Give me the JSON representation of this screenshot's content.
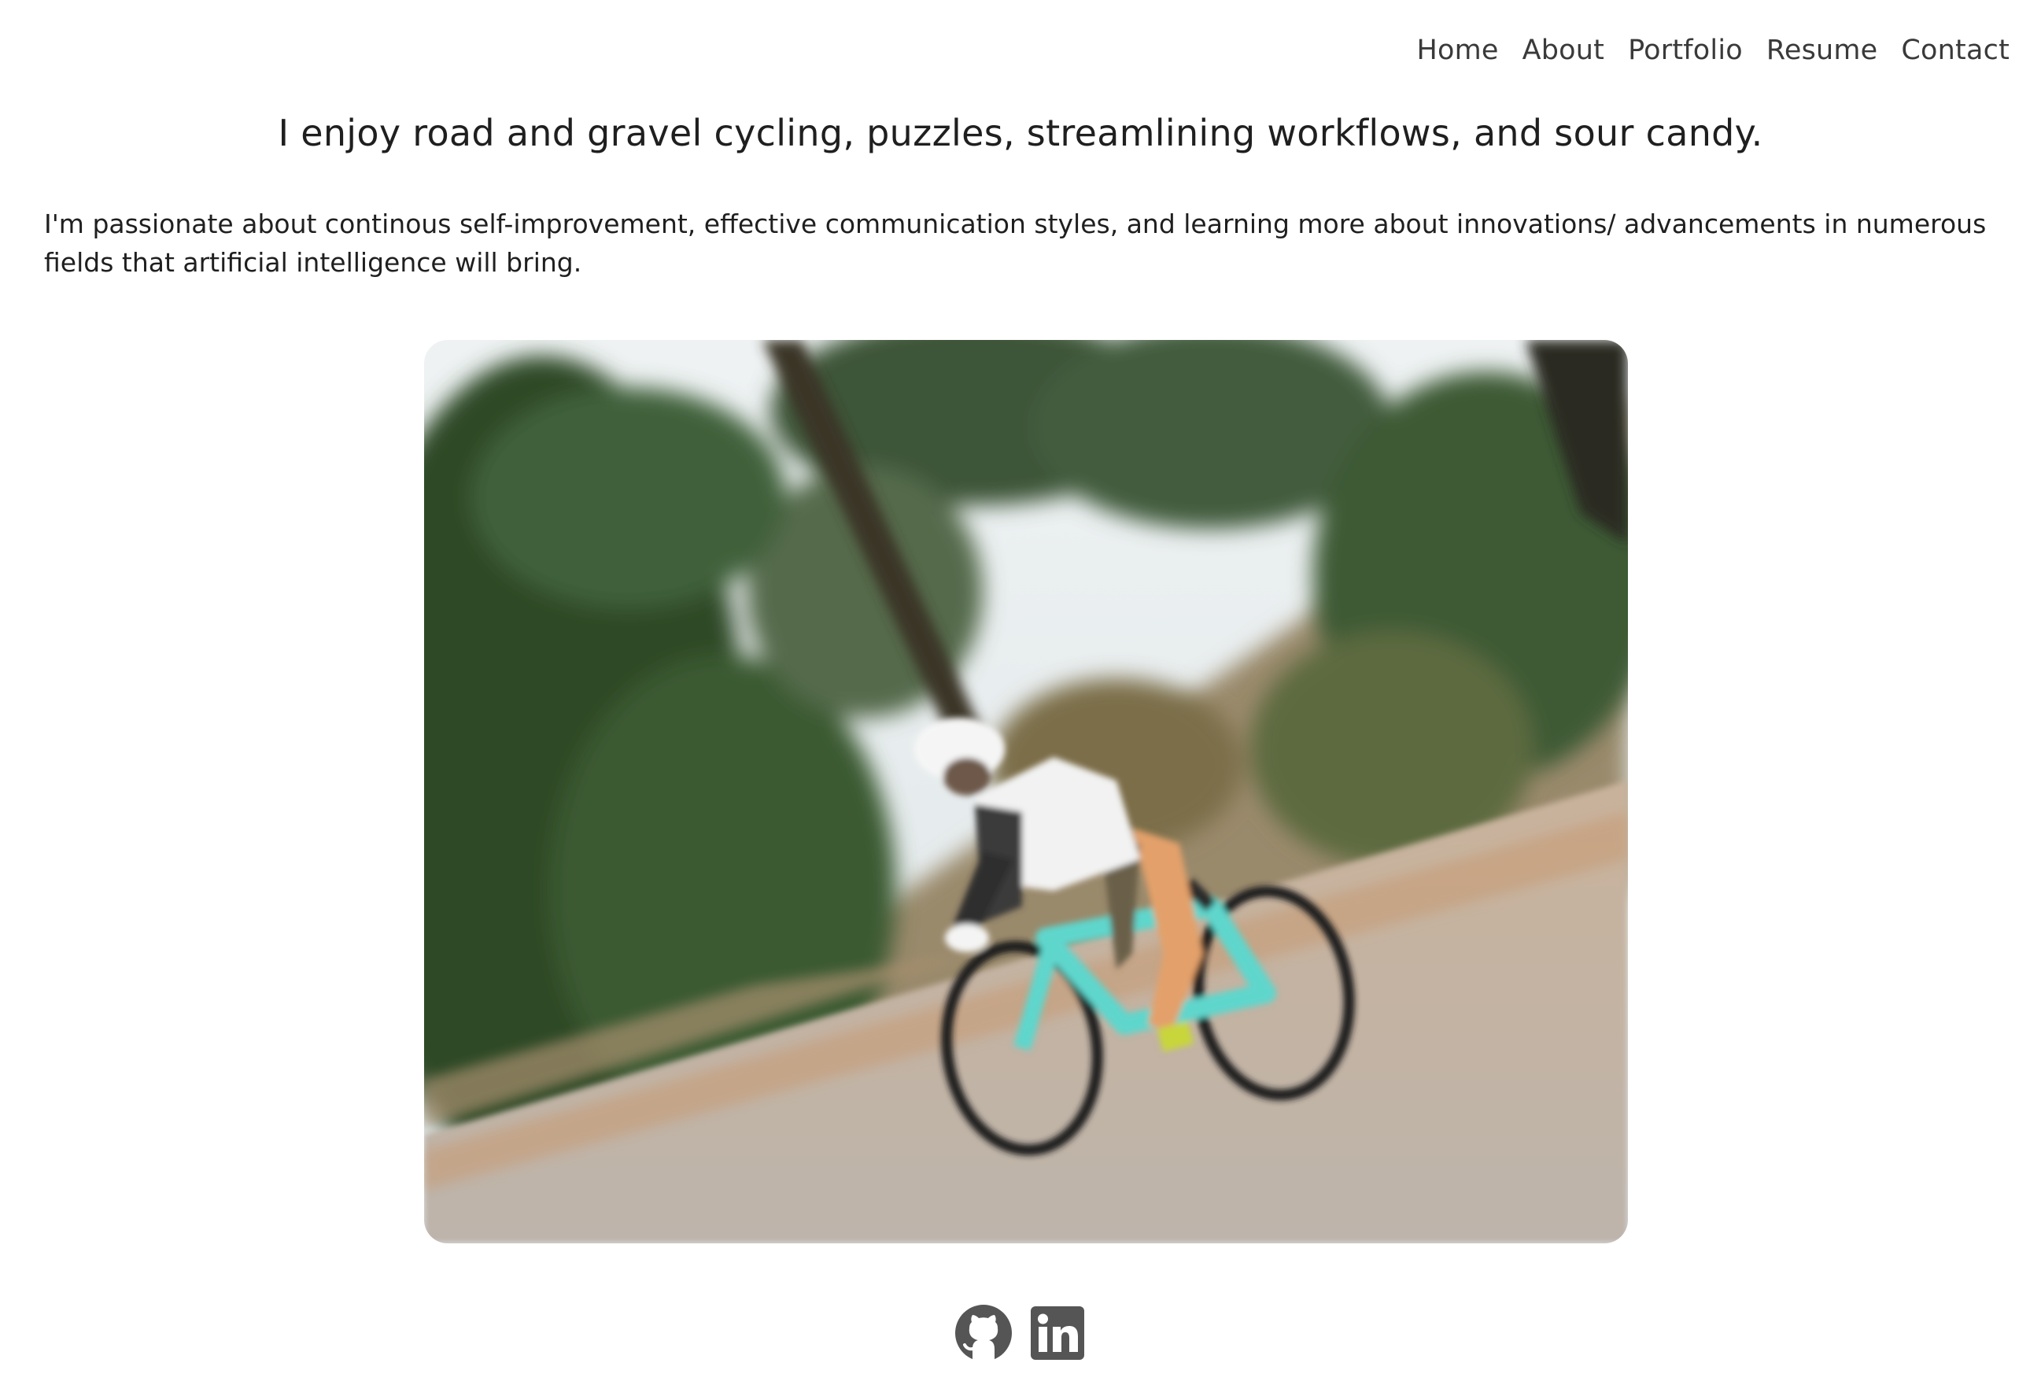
{
  "nav": {
    "items": [
      {
        "label": "Home"
      },
      {
        "label": "About"
      },
      {
        "label": "Portfolio"
      },
      {
        "label": "Resume"
      },
      {
        "label": "Contact"
      }
    ]
  },
  "about": {
    "headline": "I enjoy road and gravel cycling, puzzles, streamlining workflows, and sour candy.",
    "bio": "I'm passionate about continous self-improvement, effective communication styles, and learning more about innovations/ advancements in numerous fields that artificial intelligence will bring."
  },
  "photo": {
    "subject": "cyclist-on-teal-road-bike",
    "colors": {
      "sky": "#e6ecef",
      "foliage": "#2f4f2a",
      "road": "#b9aea0",
      "bike": "#5fd6cc"
    }
  },
  "socials": [
    {
      "icon": "github-icon",
      "color": "#555555"
    },
    {
      "icon": "linkedin-icon",
      "color": "#555555"
    }
  ]
}
